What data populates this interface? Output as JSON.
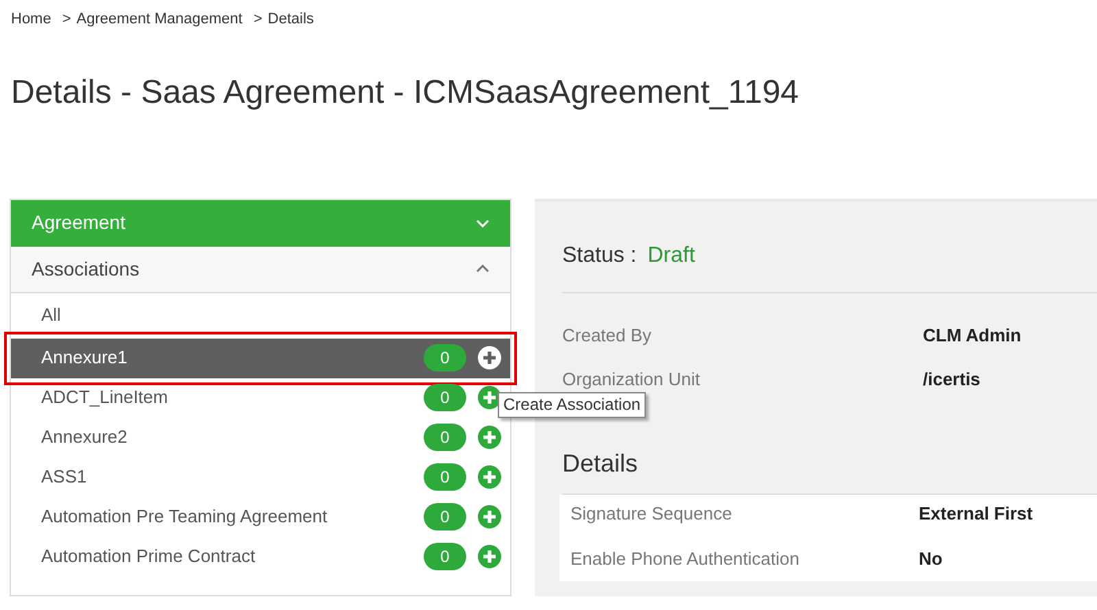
{
  "breadcrumb": [
    "Home",
    "Agreement Management",
    "Details"
  ],
  "breadcrumb_separator": ">",
  "page_title": "Details - Saas Agreement - ICMSaasAgreement_1194",
  "sidebar": {
    "sections": [
      {
        "label": "Agreement",
        "expanded": false,
        "active": true
      },
      {
        "label": "Associations",
        "expanded": true,
        "active": false
      }
    ],
    "all_item": "All",
    "items": [
      {
        "label": "Annexure1",
        "count": "0",
        "selected": true,
        "highlighted": true
      },
      {
        "label": "ADCT_LineItem",
        "count": "0",
        "selected": false,
        "highlighted": false
      },
      {
        "label": "Annexure2",
        "count": "0",
        "selected": false,
        "highlighted": false
      },
      {
        "label": "ASS1",
        "count": "0",
        "selected": false,
        "highlighted": false
      },
      {
        "label": "Automation Pre Teaming Agreement",
        "count": "0",
        "selected": false,
        "highlighted": false
      },
      {
        "label": "Automation Prime Contract",
        "count": "0",
        "selected": false,
        "highlighted": false
      }
    ]
  },
  "tooltip": "Create Association",
  "status": {
    "label": "Status :",
    "value": "Draft"
  },
  "summary_fields": [
    {
      "label": "Created By",
      "value": "CLM Admin"
    },
    {
      "label": "Organization Unit",
      "value": "/icertis"
    }
  ],
  "details": {
    "title": "Details",
    "fields": [
      {
        "label": "Signature Sequence",
        "value": "External First"
      },
      {
        "label": "Enable Phone Authentication",
        "value": "No"
      }
    ]
  }
}
